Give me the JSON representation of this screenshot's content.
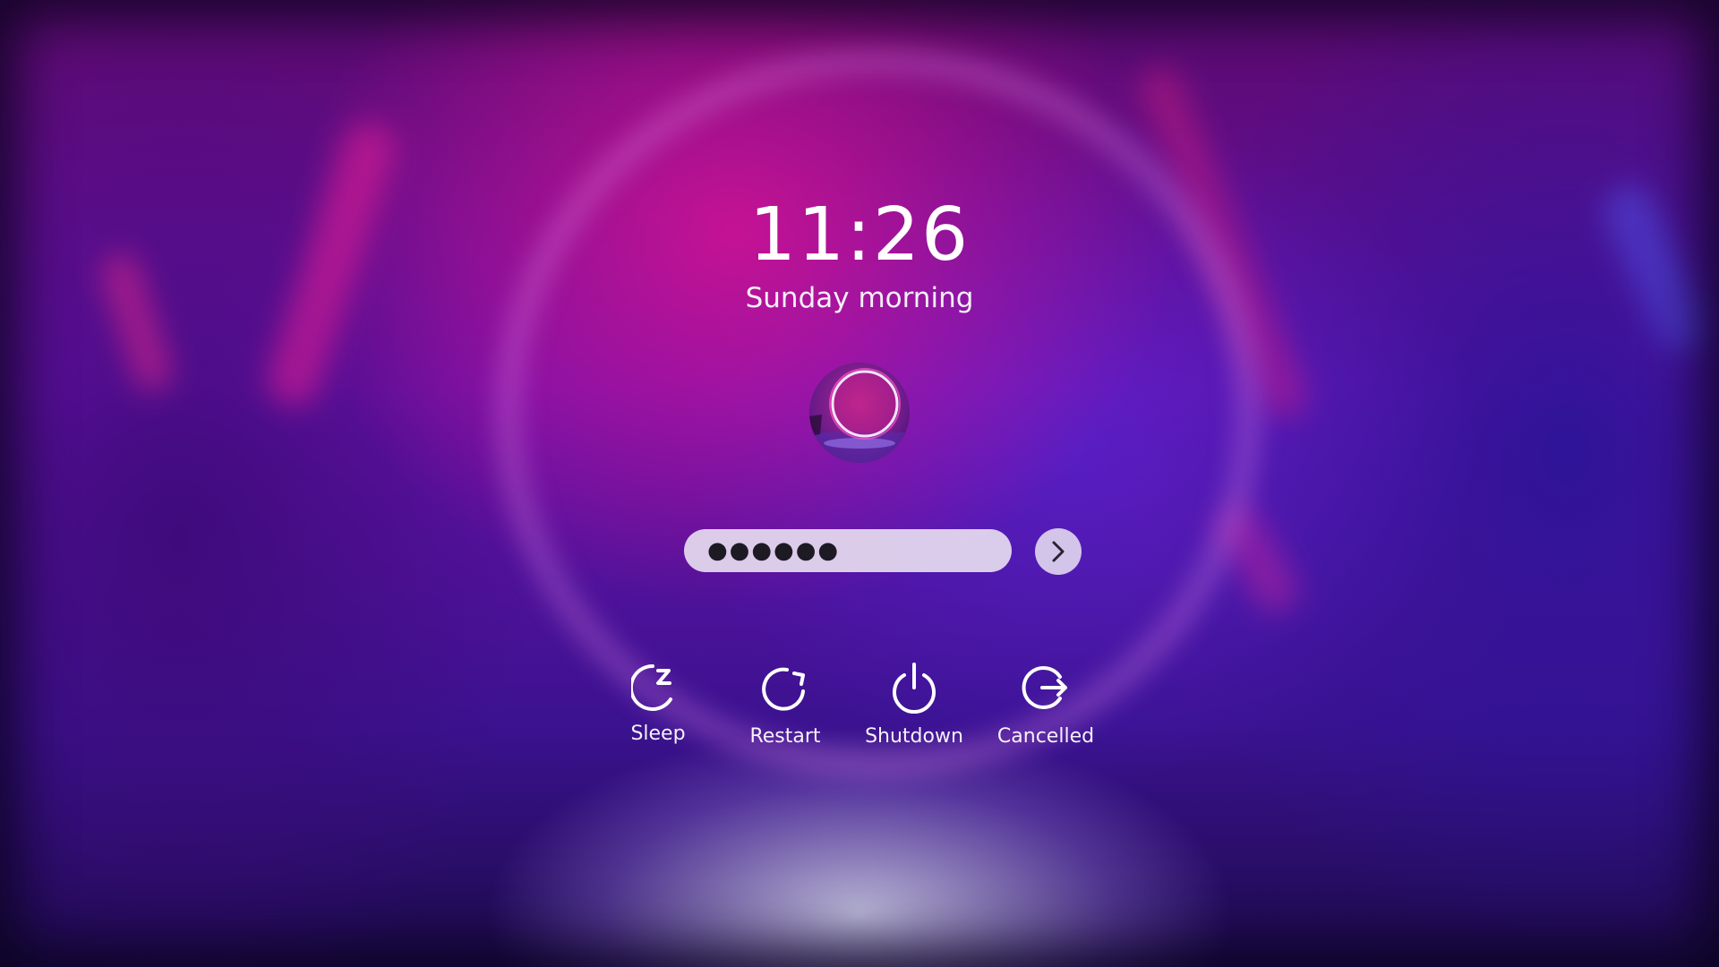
{
  "lockscreen": {
    "time": "11:26",
    "date_text": "Sunday morning",
    "password_mask": "●●●●●●",
    "accent_color": "#e6dcf0",
    "user_avatar": "neon-ring-avatar"
  },
  "actions": [
    {
      "label": "Sleep",
      "icon": "sleep-icon"
    },
    {
      "label": "Restart",
      "icon": "restart-icon"
    },
    {
      "label": "Shutdown",
      "icon": "power-icon"
    },
    {
      "label": "Cancelled",
      "icon": "logout-icon"
    }
  ],
  "submit": {
    "icon": "chevron-right-icon"
  }
}
